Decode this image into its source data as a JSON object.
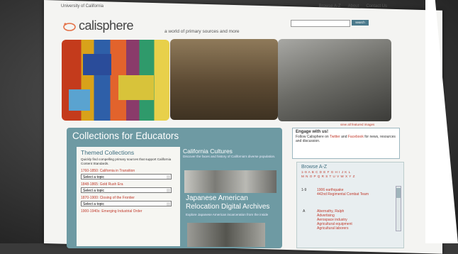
{
  "header": {
    "university": "University of California",
    "links": [
      "Browse A-Z",
      "About",
      "Contact Us"
    ],
    "search_button": "search"
  },
  "logo": {
    "wordmark": "calisphere"
  },
  "tagline": "a world of primary sources and more",
  "featured": {
    "caption": "view all featured images"
  },
  "educators": {
    "title": "Collections for Educators",
    "themed": {
      "heading": "Themed Collections",
      "description": "Quickly find compelling primary sources that support California Content Standards.",
      "eras": [
        {
          "label": "1760-1850: California in Transition",
          "select": "Select a topic"
        },
        {
          "label": "1848-1865: Gold Rush Era",
          "select": "Select a topic"
        },
        {
          "label": "1870-1900: Closing of the Frontier",
          "select": "Select a topic"
        },
        {
          "label": "1900-1940s: Emerging Industrial Order",
          "select": ""
        }
      ]
    },
    "cultures": {
      "heading": "California Cultures",
      "description": "Discover the faces and history of California's diverse population.",
      "feature_title": "Japanese American Relocation Digital Archives",
      "feature_desc": "Explore Japanese American incarceration from the inside"
    }
  },
  "engage": {
    "heading": "Engage with us!",
    "line1": "Follow Calisphere on",
    "twitter": "Twitter",
    "and": "and",
    "facebook": "Facebook",
    "line2": "for news, resources and discussion."
  },
  "browse": {
    "heading": "Browse A-Z",
    "alphabet_1": "1-9 A B C D E F G H I J K L",
    "alphabet_2": "M N O P Q R S T U V W X Y Z",
    "rows": [
      {
        "key": "1-9",
        "values": [
          "1906 earthquake",
          "442nd Regimental Combat Team"
        ]
      },
      {
        "key": "A",
        "values": [
          "Abernathy, Ralph",
          "Advertising",
          "Aerospace industry",
          "Agricultural equipment",
          "Agricultural laborers"
        ]
      }
    ]
  },
  "colors": {
    "accent": "#6e9aa3",
    "link": "#c0392b",
    "heading": "#3f6f80"
  }
}
